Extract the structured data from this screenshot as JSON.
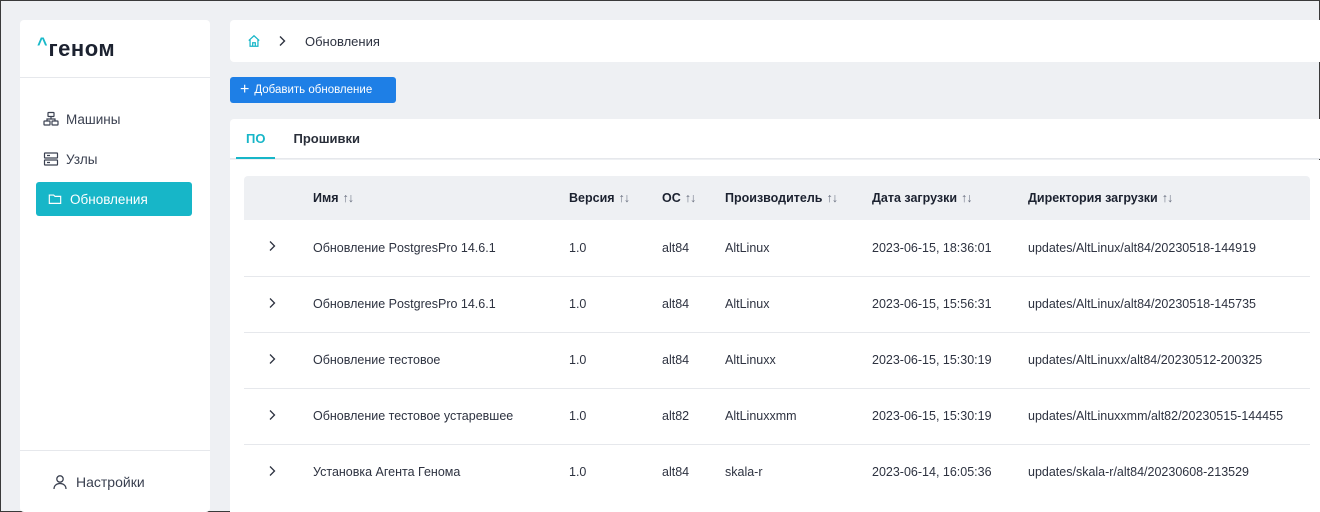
{
  "logo": {
    "mark": "^",
    "text": "геном"
  },
  "sidebar": {
    "items": [
      {
        "label": "Машины",
        "icon": "machines-icon",
        "active": false
      },
      {
        "label": "Узлы",
        "icon": "nodes-icon",
        "active": false
      },
      {
        "label": "Обновления",
        "icon": "folder-icon",
        "active": true
      }
    ],
    "footer": {
      "label": "Настройки",
      "icon": "user-icon"
    }
  },
  "breadcrumb": {
    "current": "Обновления"
  },
  "toolbar": {
    "add_label": "Добавить обновление"
  },
  "tabs": [
    {
      "label": "ПО",
      "active": true
    },
    {
      "label": "Прошивки",
      "active": false
    }
  ],
  "table": {
    "columns": [
      "Имя",
      "Версия",
      "ОС",
      "Производитель",
      "Дата загрузки",
      "Директория загрузки"
    ],
    "sort_icon": "↑↓",
    "rows": [
      [
        "Обновление PostgresPro 14.6.1",
        "1.0",
        "alt84",
        "AltLinux",
        "2023-06-15, 18:36:01",
        "updates/AltLinux/alt84/20230518-144919"
      ],
      [
        "Обновление PostgresPro 14.6.1",
        "1.0",
        "alt84",
        "AltLinux",
        "2023-06-15, 15:56:31",
        "updates/AltLinux/alt84/20230518-145735"
      ],
      [
        "Обновление тестовое",
        "1.0",
        "alt84",
        "AltLinuxx",
        "2023-06-15, 15:30:19",
        "updates/AltLinuxx/alt84/20230512-200325"
      ],
      [
        "Обновление тестовое устаревшее",
        "1.0",
        "alt82",
        "AltLinuxxmm",
        "2023-06-15, 15:30:19",
        "updates/AltLinuxxmm/alt82/20230515-144455"
      ],
      [
        "Установка Агента Генома",
        "1.0",
        "alt84",
        "skala-r",
        "2023-06-14, 16:05:36",
        "updates/skala-r/alt84/20230608-213529"
      ]
    ]
  },
  "colors": {
    "accent": "#17b6c8",
    "primary_button": "#1e7fe6",
    "background": "#eef0f3"
  }
}
